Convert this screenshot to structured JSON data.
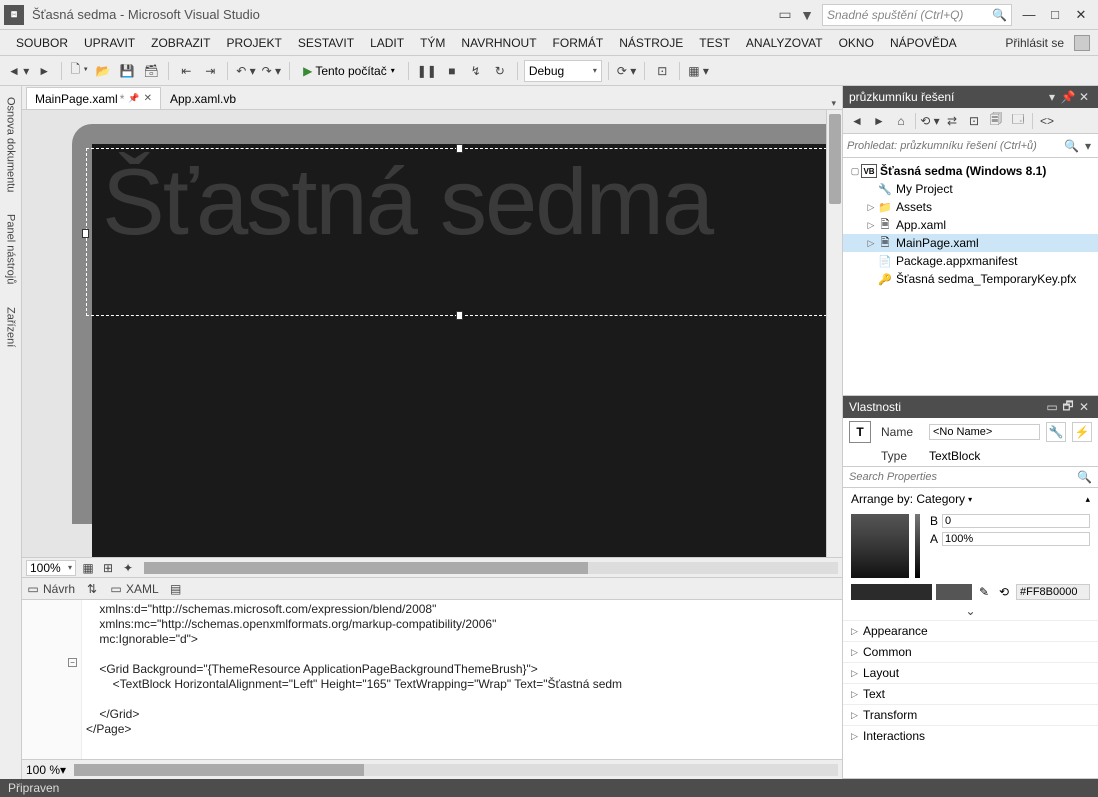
{
  "title": "Šťasná sedma - Microsoft Visual Studio",
  "quick_launch_placeholder": "Snadné spuštění (Ctrl+Q)",
  "menu": [
    "SOUBOR",
    "UPRAVIT",
    "ZOBRAZIT",
    "PROJEKT",
    "SESTAVIT",
    "LADIT",
    "TÝM",
    "NAVRHNOUT",
    "FORMÁT",
    "NÁSTROJE",
    "TEST",
    "ANALYZOVAT",
    "OKNO",
    "NÁPOVĚDA"
  ],
  "sign_in": "Přihlásit se",
  "toolbar": {
    "start_label": "Tento počítač",
    "config": "Debug"
  },
  "left_tabs": [
    "Osnova dokumentu",
    "Panel nástrojů",
    "Zařízení"
  ],
  "doc_tabs": [
    {
      "label": "MainPage.xaml",
      "modified": true,
      "pinned": true,
      "active": true
    },
    {
      "label": "App.xaml.vb",
      "modified": false,
      "pinned": false,
      "active": false
    }
  ],
  "designer": {
    "big_text": "Šťastná sedma",
    "zoom": "100%",
    "zoom2": "100 %",
    "split": {
      "design": "Návrh",
      "xaml": "XAML"
    }
  },
  "code_lines": [
    "    xmlns:d=\"http://schemas.microsoft.com/expression/blend/2008\"",
    "    xmlns:mc=\"http://schemas.openxmlformats.org/markup-compatibility/2006\"",
    "    mc:Ignorable=\"d\">",
    "",
    "    <Grid Background=\"{ThemeResource ApplicationPageBackgroundThemeBrush}\">",
    "        <TextBlock HorizontalAlignment=\"Left\" Height=\"165\" TextWrapping=\"Wrap\" Text=\"Šťastná sedm",
    "",
    "    </Grid>",
    "</Page>"
  ],
  "solution_explorer": {
    "title": "průzkumníku řešení",
    "search_placeholder": "Prohledat: průzkumníku řešení (Ctrl+ů)",
    "root": "Šťasná sedma (Windows 8.1)",
    "items": [
      {
        "label": "My Project",
        "icon": "wrench"
      },
      {
        "label": "Assets",
        "icon": "folder",
        "expandable": true
      },
      {
        "label": "App.xaml",
        "icon": "xaml",
        "expandable": true
      },
      {
        "label": "MainPage.xaml",
        "icon": "xaml",
        "expandable": true,
        "selected": true
      },
      {
        "label": "Package.appxmanifest",
        "icon": "manifest"
      },
      {
        "label": "Šťasná sedma_TemporaryKey.pfx",
        "icon": "key"
      }
    ]
  },
  "properties": {
    "title": "Vlastnosti",
    "name_label": "Name",
    "name_value": "<No Name>",
    "type_label": "Type",
    "type_value": "TextBlock",
    "search_placeholder": "Search Properties",
    "arrange_label": "Arrange by: Category",
    "brush": {
      "b": "0",
      "a": "100%",
      "hex": "#FF8B0000"
    },
    "categories": [
      "Appearance",
      "Common",
      "Layout",
      "Text",
      "Transform",
      "Interactions"
    ]
  },
  "status": "Připraven"
}
